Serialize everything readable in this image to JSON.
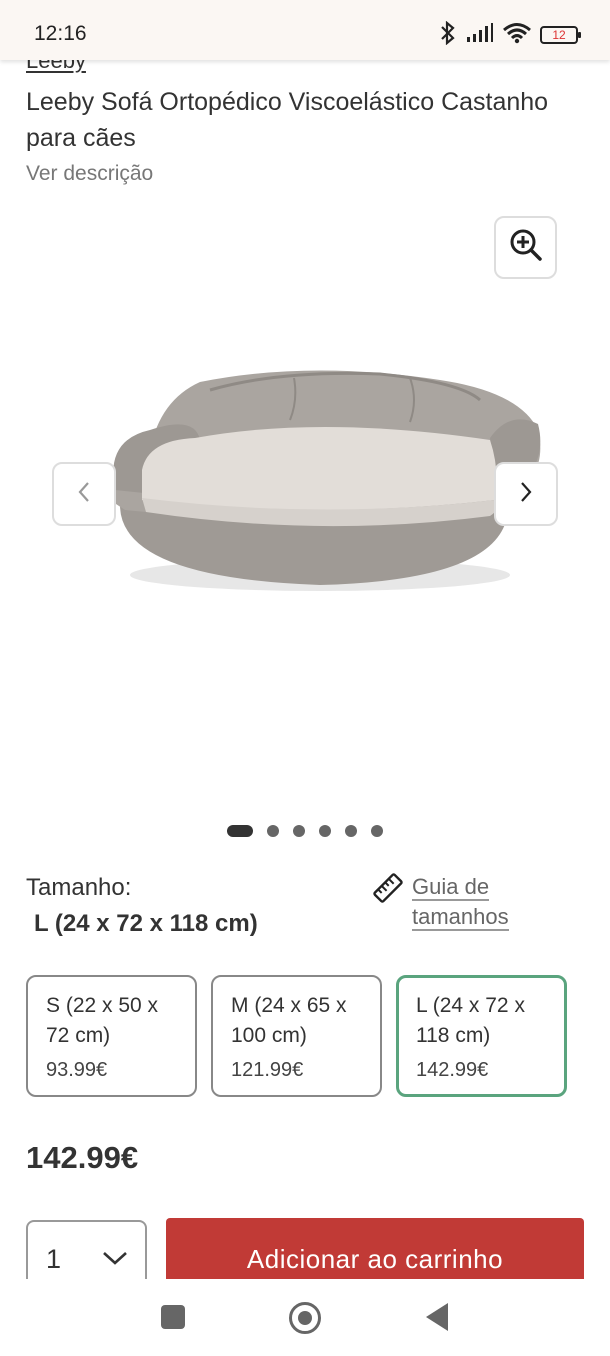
{
  "status_bar": {
    "time": "12:16",
    "battery": "12",
    "icons": [
      "bluetooth-icon",
      "signal-icon",
      "wifi-icon",
      "battery-icon"
    ]
  },
  "product": {
    "brand": "Leeby",
    "title": "Leeby Sofá Ortopédico Viscoelástico Castanho para cães",
    "description_link": "Ver descrição"
  },
  "gallery": {
    "image_count": 6,
    "active_index": 0
  },
  "size": {
    "label": "Tamanho:",
    "selected": "L (24 x 72 x 118 cm)",
    "guide_line1": "Guia de",
    "guide_line2": "tamanhos",
    "options": [
      {
        "name": "S (22 x 50 x 72 cm)",
        "price": "93.99€",
        "selected": false
      },
      {
        "name": "M (24 x 65 x 100 cm)",
        "price": "121.99€",
        "selected": false
      },
      {
        "name": "L (24 x 72 x 118 cm)",
        "price": "142.99€",
        "selected": true
      }
    ]
  },
  "price": "142.99€",
  "purchase": {
    "quantity": "1",
    "add_to_cart": "Adicionar ao carrinho"
  },
  "colors": {
    "accent_red": "#c13a36",
    "selected_green": "#5aa47e"
  }
}
